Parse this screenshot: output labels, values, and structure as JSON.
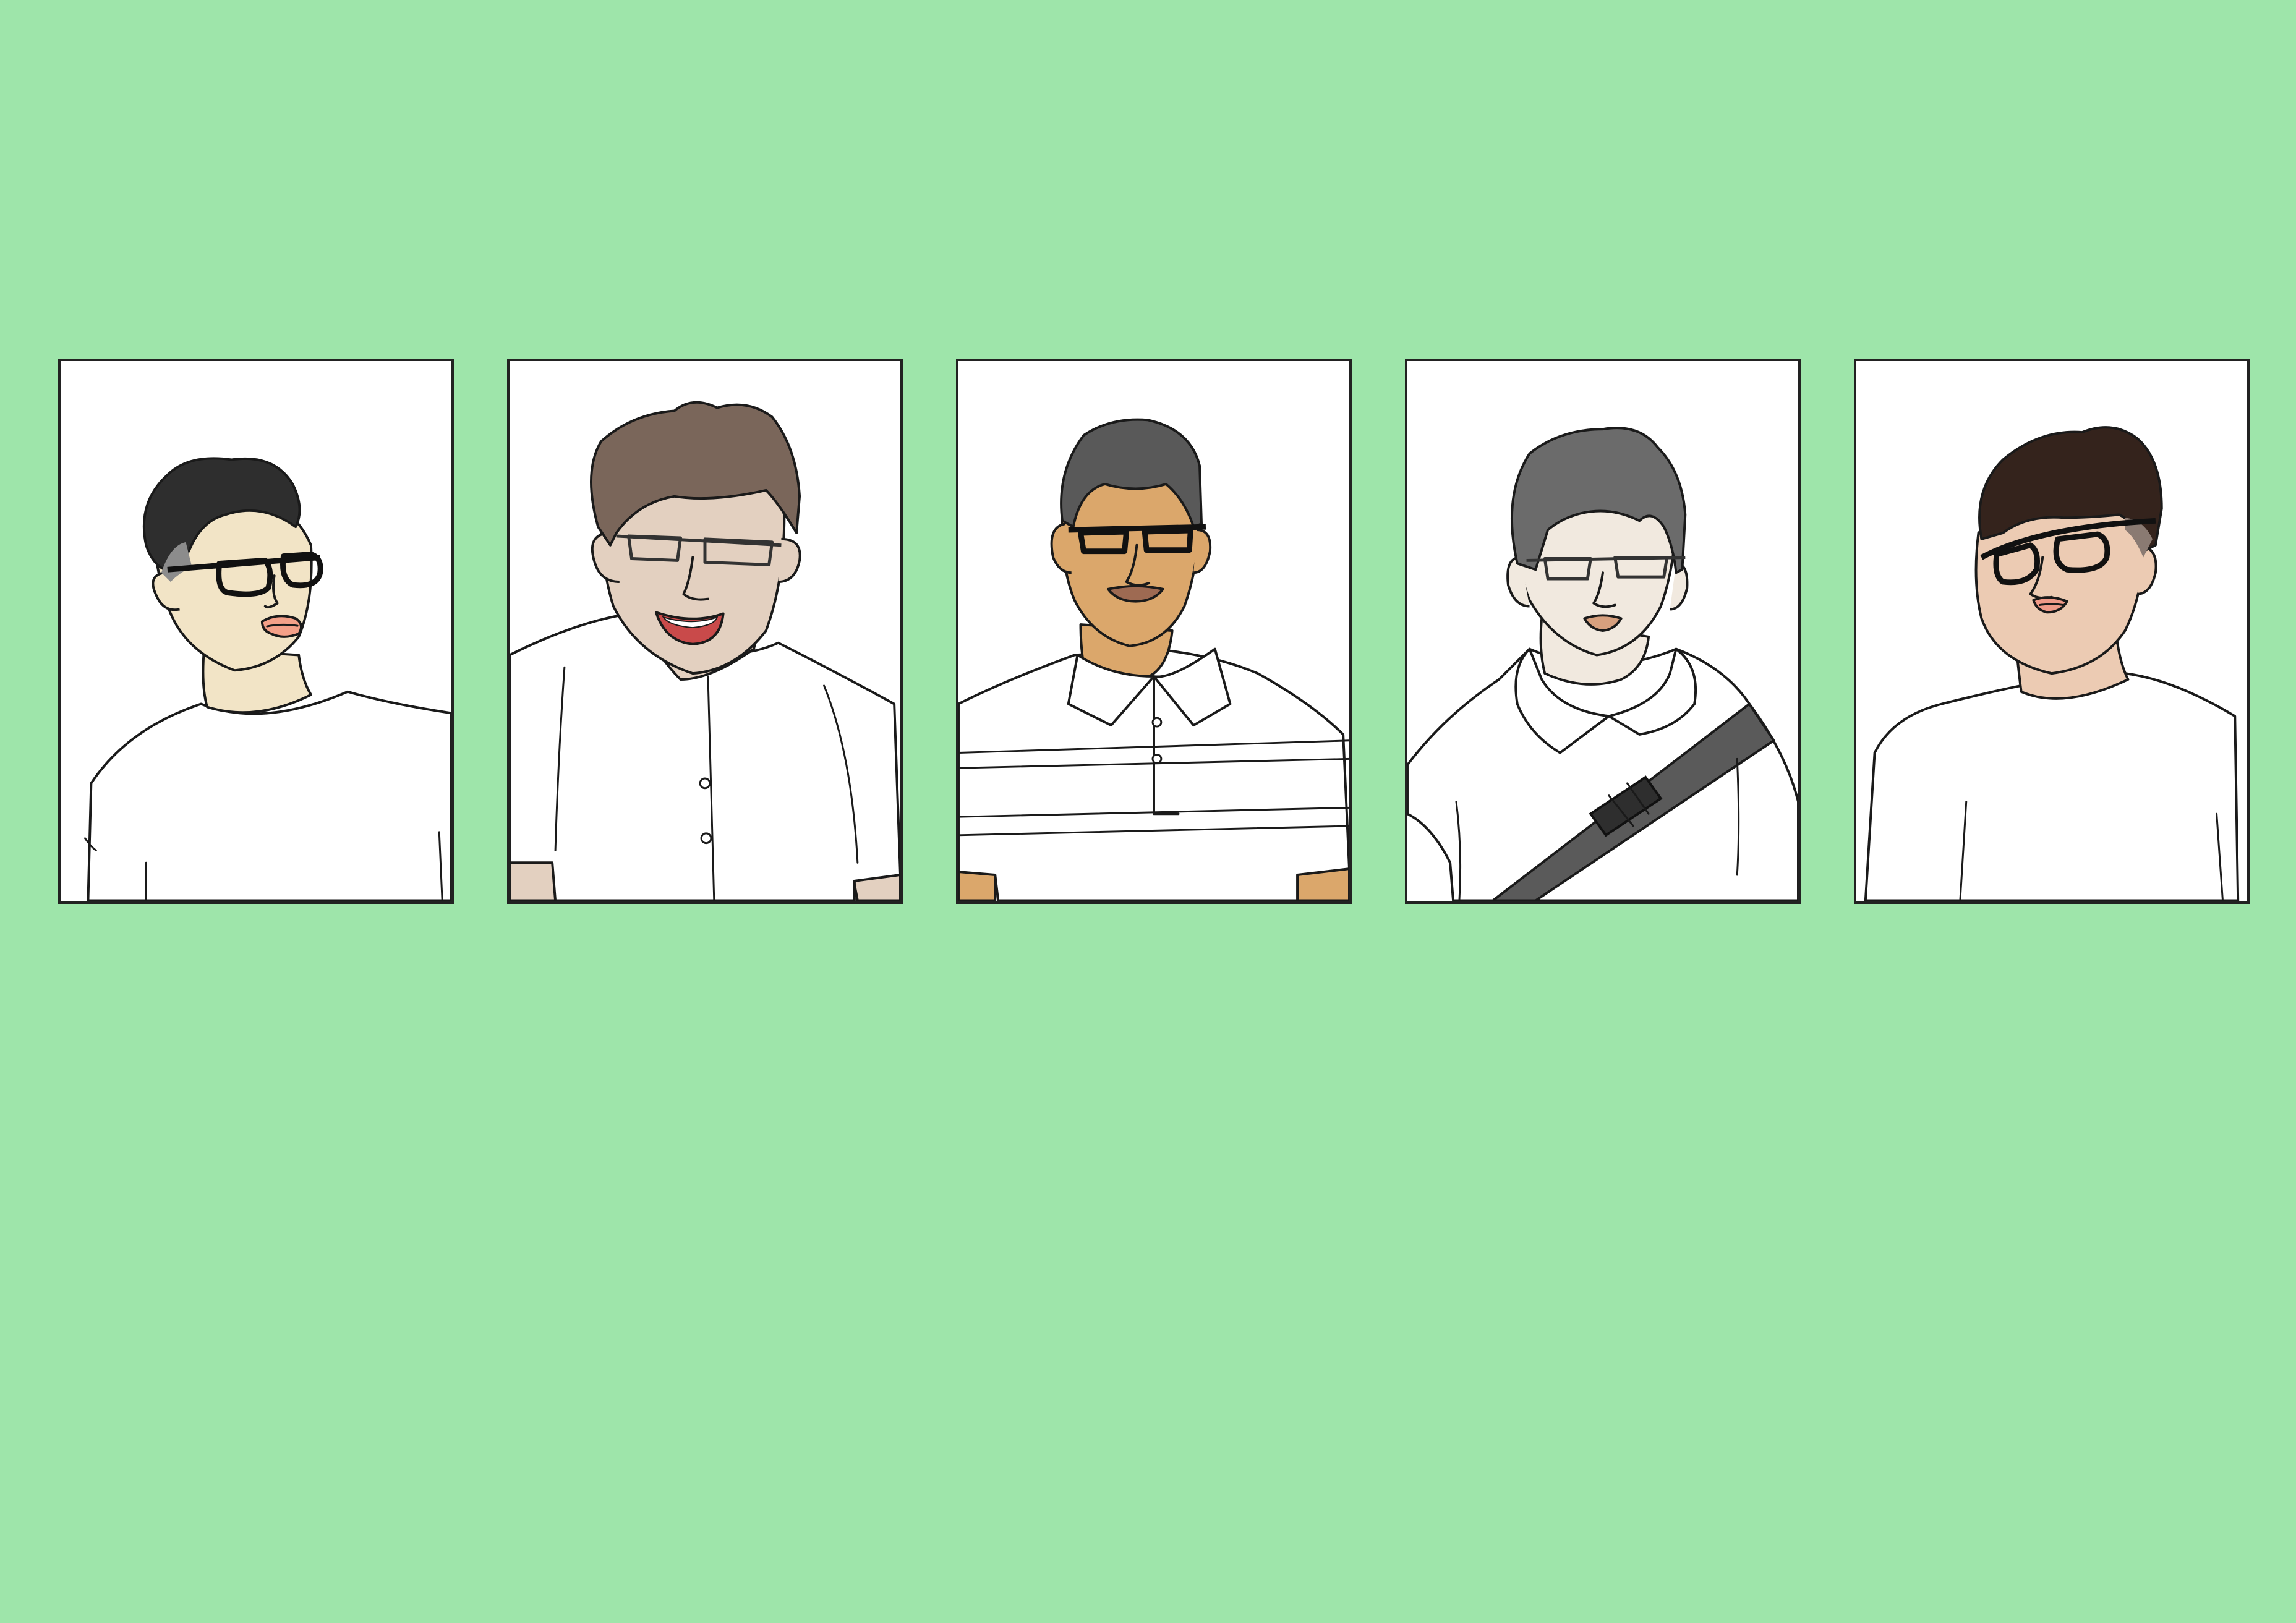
{
  "illustration": {
    "background_color": "#9ee5aa",
    "card_background_color": "#ffffff",
    "card_border_color": "#222222",
    "portraits": [
      {
        "skin_color": "#f2e4c6",
        "hair_color": "#2e2e2e",
        "hair_highlight_color": "#8c8c8c",
        "lip_color": "#f4a088",
        "glasses_style": "thick-black",
        "shirt": "plain-white-tshirt"
      },
      {
        "skin_color": "#e3d0c0",
        "hair_color": "#7a665a",
        "lip_color": "#c94a4a",
        "glasses_style": "thin-rectangular",
        "shirt": "white-button-shirt"
      },
      {
        "skin_color": "#dba76b",
        "hair_color": "#595959",
        "lip_color": "#9e6a52",
        "glasses_style": "thick-black",
        "shirt": "striped-polo"
      },
      {
        "skin_color": "#f1e9df",
        "hair_color": "#6b6b6b",
        "lip_color": "#d7a07e",
        "glasses_style": "thin-rectangular",
        "shirt": "white-hoodie-with-strap",
        "strap_color": "#5a5a5a"
      },
      {
        "skin_color": "#eccbb3",
        "hair_color": "#34231c",
        "hair_highlight_color": "#8a7a72",
        "lip_color": "#f09a88",
        "glasses_style": "thick-black",
        "shirt": "plain-white-tshirt"
      }
    ]
  }
}
